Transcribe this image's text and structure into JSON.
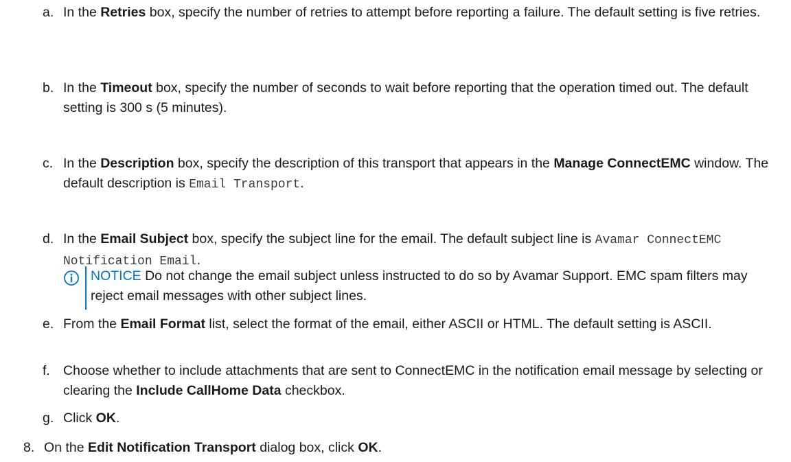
{
  "steps": [
    {
      "label": "a.",
      "parts": [
        "In the ",
        "Retries",
        " box, specify the number of retries to attempt before reporting a failure. The default setting is five retries."
      ]
    },
    {
      "label": "b.",
      "parts": [
        "In the ",
        "Timeout",
        " box, specify the number of seconds to wait before reporting that the operation timed out. The default setting is 300 s (5 minutes)."
      ]
    },
    {
      "label": "c.",
      "parts": [
        "In the ",
        "Description",
        " box, specify the description of this transport that appears in the ",
        "Manage ConnectEMC",
        " window. The default description is ",
        "Email Transport",
        "."
      ]
    },
    {
      "label": "d.",
      "parts": [
        "In the ",
        "Email Subject",
        " box, specify the subject line for the email. The default subject line is ",
        "Avamar ConnectEMC Notification Email",
        "."
      ]
    },
    {
      "label": "e.",
      "parts": [
        "From the ",
        "Email Format",
        " list, select the format of the email, either ASCII or HTML. The default setting is ASCII."
      ]
    },
    {
      "label": "f.",
      "parts": [
        "Choose whether to include attachments that are sent to ConnectEMC in the notification email message by selecting or clearing the ",
        "Include CallHome Data",
        " checkbox."
      ]
    },
    {
      "label": "g.",
      "parts": [
        "Click ",
        "OK",
        "."
      ]
    }
  ],
  "notice": {
    "label": "NOTICE",
    "text": " Do not change the email subject unless instructed to do so by Avamar Support. EMC spam filters may reject email messages with other subject lines."
  },
  "step8": {
    "label": "8.",
    "parts": [
      "On the ",
      "Edit Notification Transport",
      " dialog box, click ",
      "OK",
      "."
    ]
  },
  "colors": {
    "accent": "#0076ce",
    "text": "#1a1a1a"
  },
  "icons": {
    "notice": "info-circle-icon"
  }
}
